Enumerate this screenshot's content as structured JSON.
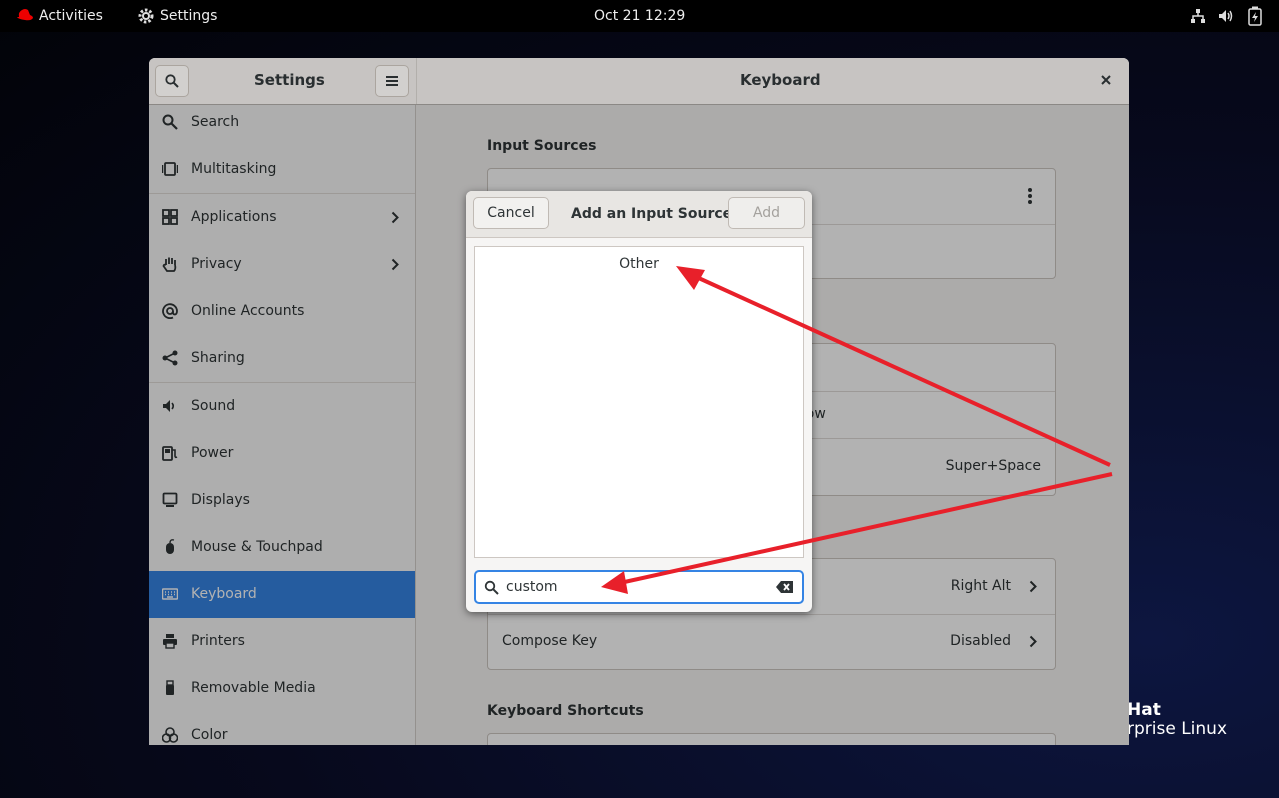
{
  "topbar": {
    "activities": "Activities",
    "app": "Settings",
    "datetime": "Oct 21  12:29"
  },
  "wallpaper": {
    "brand_line1": "Hat",
    "brand_line2": "rprise Linux"
  },
  "window": {
    "sidebar_title": "Settings",
    "content_title": "Keyboard",
    "sidebar_items": [
      {
        "label": "Search",
        "icon": "search-icon"
      },
      {
        "label": "Multitasking",
        "icon": "multitasking-icon"
      },
      {
        "label": "Applications",
        "icon": "applications-icon"
      },
      {
        "label": "Privacy",
        "icon": "hand-icon"
      },
      {
        "label": "Online Accounts",
        "icon": "at-icon"
      },
      {
        "label": "Sharing",
        "icon": "share-icon"
      },
      {
        "label": "Sound",
        "icon": "speaker-icon"
      },
      {
        "label": "Power",
        "icon": "power-icon"
      },
      {
        "label": "Displays",
        "icon": "display-icon"
      },
      {
        "label": "Mouse & Touchpad",
        "icon": "mouse-icon"
      },
      {
        "label": "Keyboard",
        "icon": "keyboard-icon"
      },
      {
        "label": "Printers",
        "icon": "printer-icon"
      },
      {
        "label": "Removable Media",
        "icon": "usb-icon"
      },
      {
        "label": "Color",
        "icon": "color-icon"
      }
    ],
    "input_sources_title": "Input Sources",
    "partial_window_text": "ndow",
    "switch_shortcut": "Super+Space",
    "alternate_chars_value": "Right Alt",
    "compose_key_label": "Compose Key",
    "compose_key_value": "Disabled",
    "shortcuts_title": "Keyboard Shortcuts"
  },
  "dialog": {
    "cancel": "Cancel",
    "title": "Add an Input Source",
    "add": "Add",
    "list_items": [
      "Other"
    ],
    "search_value": "custom"
  },
  "colors": {
    "accent": "#3584e4",
    "annotation": "#e8202a"
  }
}
